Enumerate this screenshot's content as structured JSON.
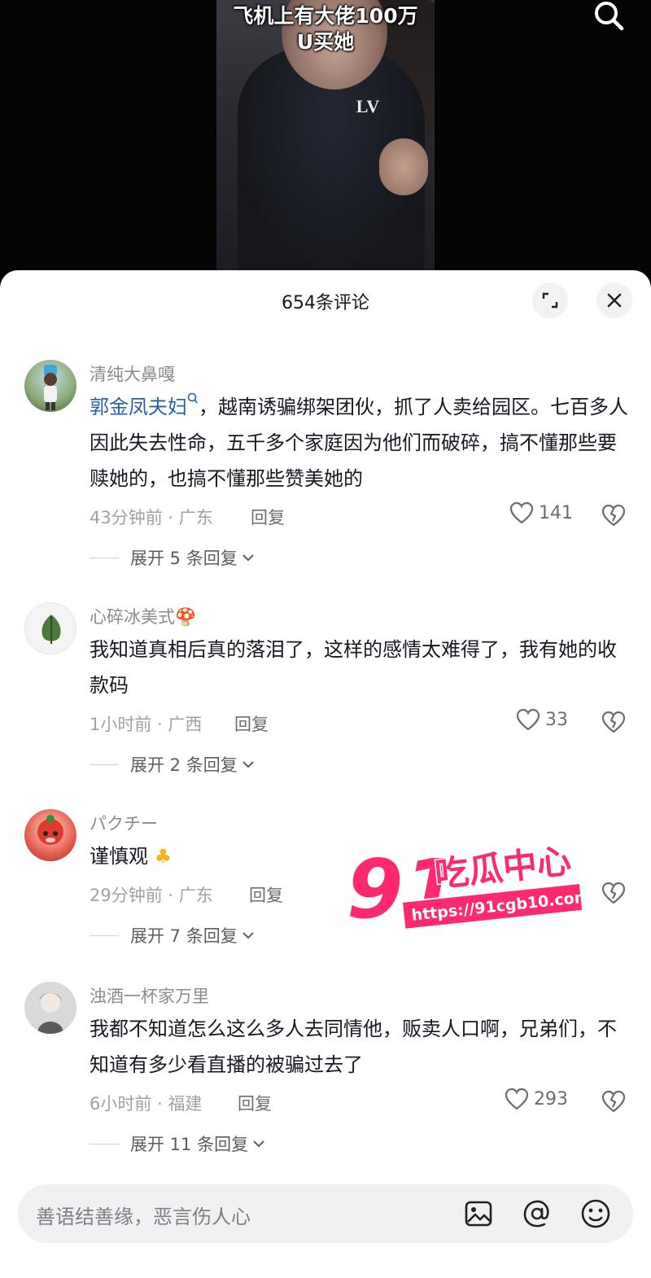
{
  "video": {
    "caption_line1": "飞机上有大佬100万",
    "caption_line2": "U买她",
    "shirt_logo": "LV",
    "search_icon": "search-icon"
  },
  "sheet": {
    "title": "654条评论",
    "expand_icon": "expand-icon",
    "close_icon": "close-icon"
  },
  "comments": [
    {
      "user": "清纯大鼻嘎",
      "mention": "郭金凤夫妇",
      "text": "，越南诱骗绑架团伙，抓了人卖给园区。七百多人因此失去性命，五千多个家庭因为他们而破碎，搞不懂那些要赎她的，也搞不懂那些赞美她的",
      "time_location": "43分钟前 · 广东",
      "reply": "回复",
      "likes": "141",
      "expand": "展开 5 条回复"
    },
    {
      "user": "心碎冰美式",
      "text": "我知道真相后真的落泪了，这样的感情太难得了，我有她的收款码",
      "time_location": "1小时前 · 广西",
      "reply": "回复",
      "likes": "33",
      "expand": "展开 2 条回复"
    },
    {
      "user": "パクチー",
      "text": "谨慎观",
      "time_location": "29分钟前 · 广东",
      "reply": "回复",
      "expand": "展开 7 条回复"
    },
    {
      "user": "浊酒一杯家万里",
      "text": "我都不知道怎么这么多人去同情他，贩卖人口啊，兄弟们，不知道有多少看直播的被骗过去了",
      "time_location": "6小时前 · 福建",
      "reply": "回复",
      "likes": "293",
      "expand": "展开 11 条回复"
    }
  ],
  "watermark": {
    "number": "91",
    "name": "吃瓜中心",
    "url": "https://91cgb10.com"
  },
  "input": {
    "placeholder": "善语结善缘，恶言伤人心",
    "icons": [
      "image-icon",
      "at-icon",
      "emoji-icon"
    ]
  },
  "colors": {
    "mention": "#2a5fa8",
    "watermark_pink": "#ff2a6d",
    "sheet_bg": "#ffffff"
  }
}
